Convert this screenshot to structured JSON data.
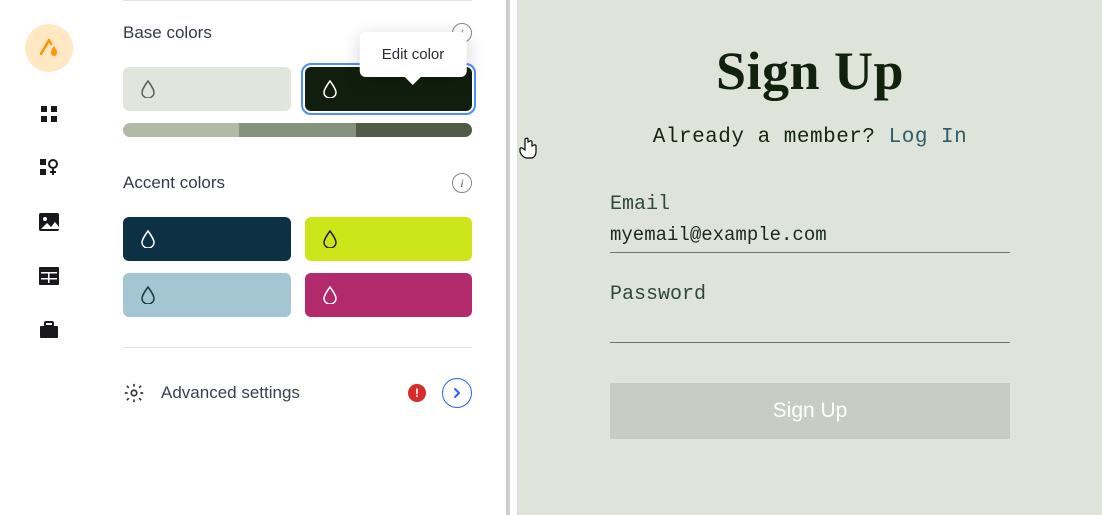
{
  "nav": {
    "logo_icon": "theme-logo"
  },
  "editor": {
    "tooltip": "Edit color",
    "base_colors_label": "Base colors",
    "accent_colors_label": "Accent colors",
    "base_swatches": [
      "#e1e5dc",
      "#111e0d"
    ],
    "gradient_segments": [
      "#b1baa7",
      "#84937b",
      "#4f5c46"
    ],
    "accent_swatches": [
      "#0c3144",
      "#cde619",
      "#a3c6d2",
      "#b32a6c"
    ],
    "advanced_label": "Advanced settings",
    "alert_glyph": "!"
  },
  "preview": {
    "title": "Sign Up",
    "member_text": "Already a member? ",
    "login_text": "Log In",
    "email_label": "Email",
    "email_value": "myemail@example.com",
    "password_label": "Password",
    "password_value": "",
    "button_label": "Sign Up"
  }
}
